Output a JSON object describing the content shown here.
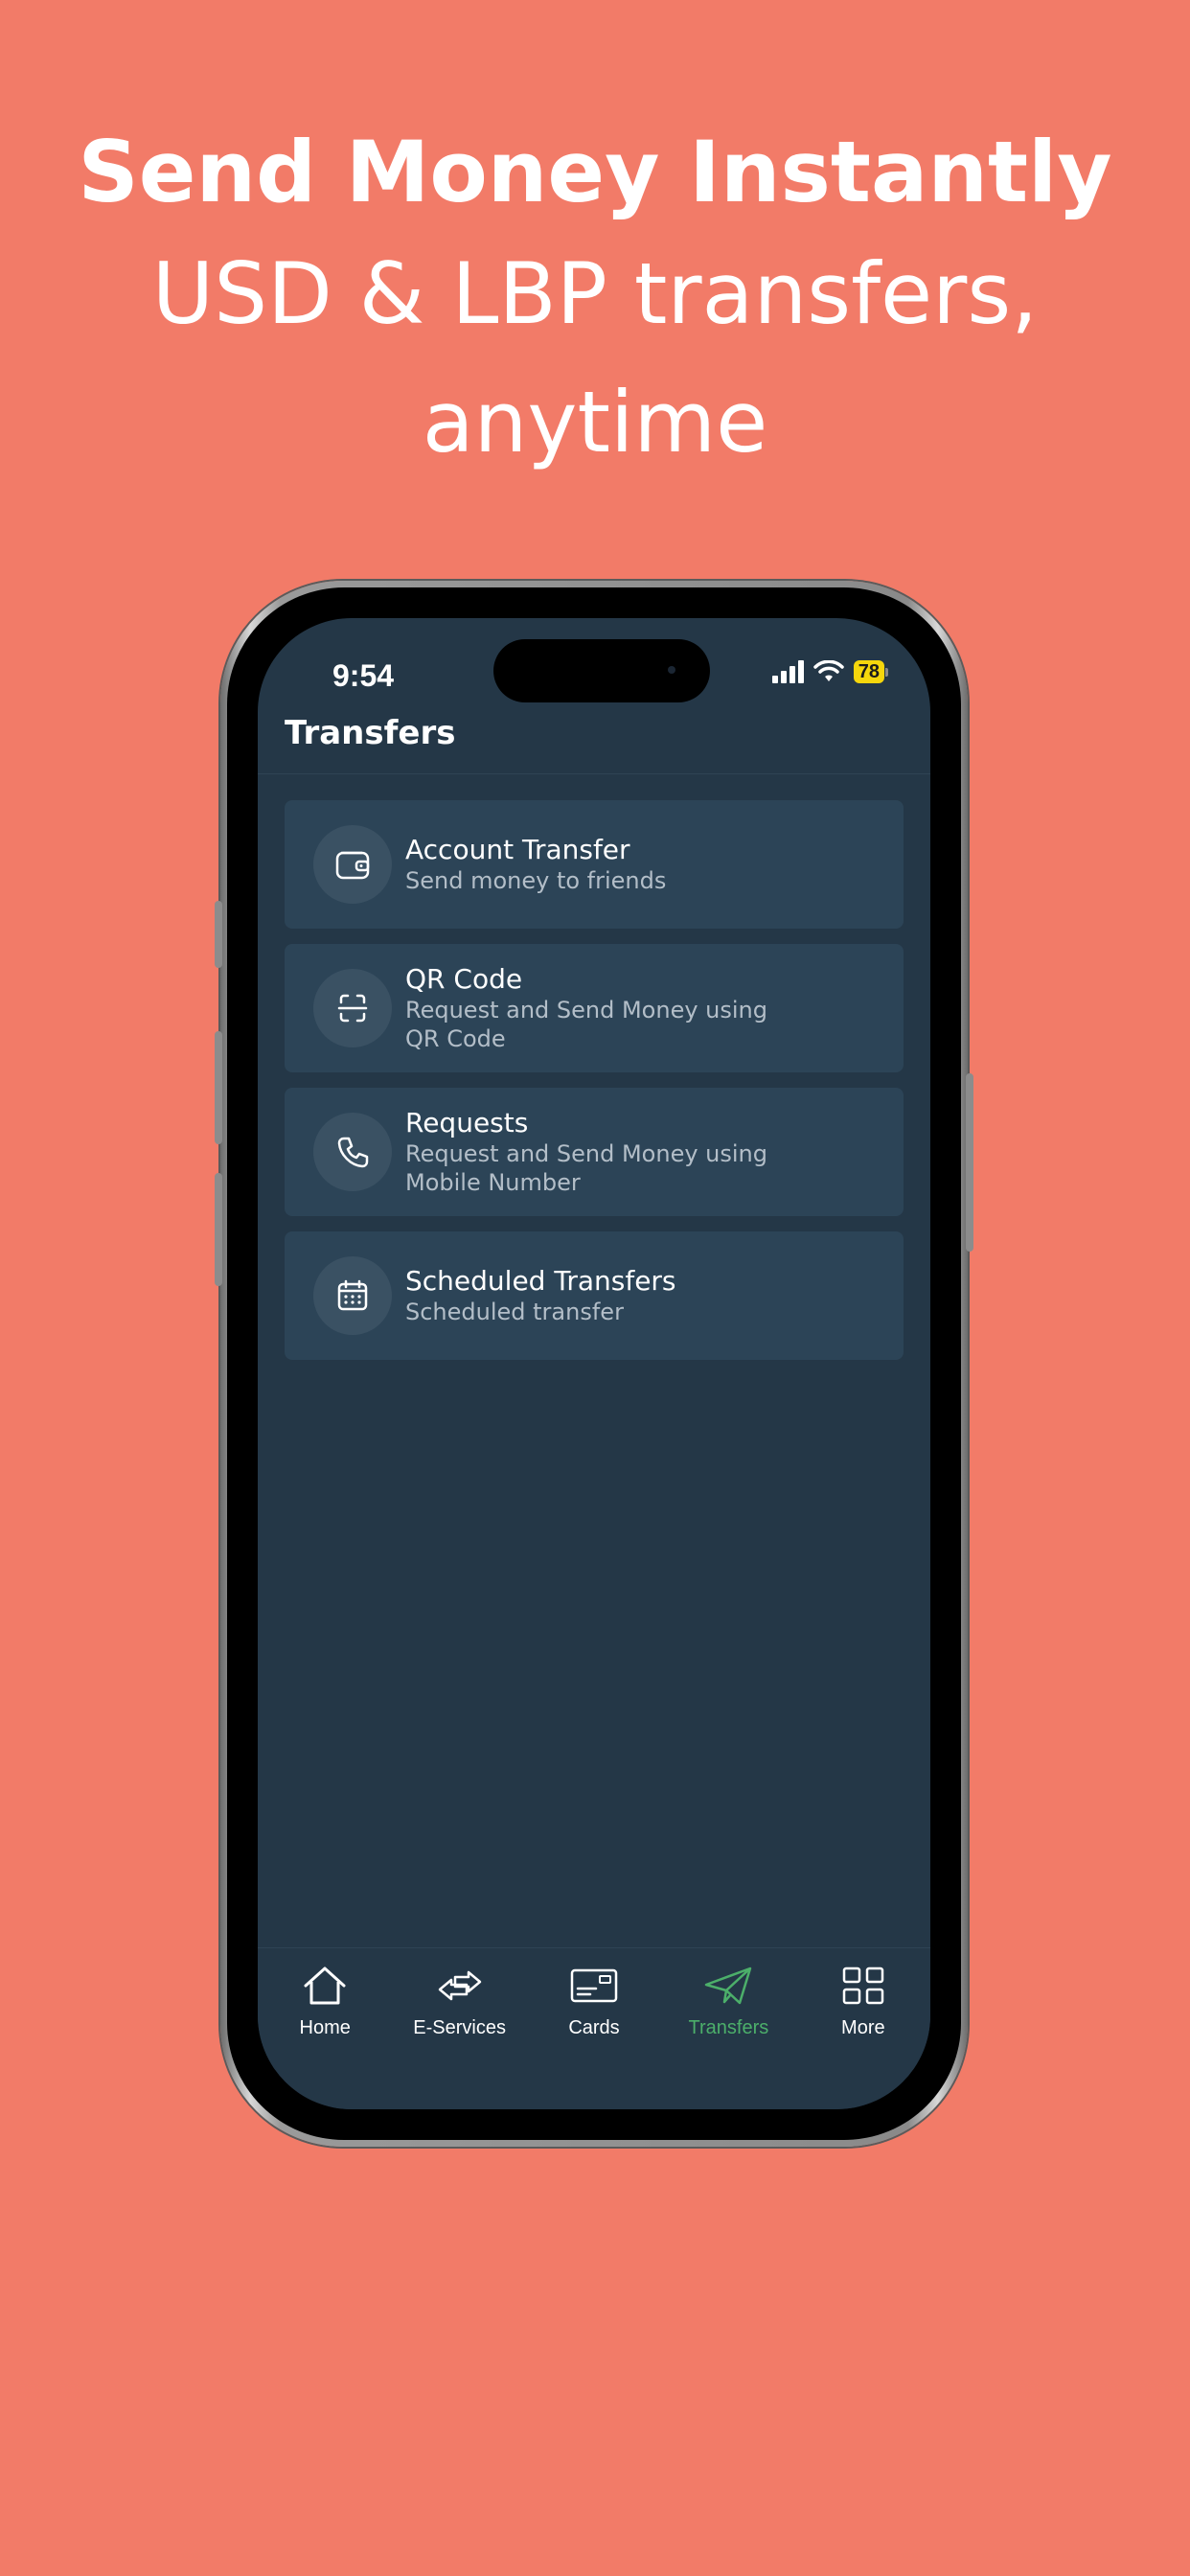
{
  "headline": {
    "title": "Send Money Instantly",
    "subtitle": "USD & LBP transfers, anytime"
  },
  "status_bar": {
    "time": "9:54",
    "battery": "78",
    "icons": [
      "signal-icon",
      "wifi-icon",
      "battery-icon"
    ]
  },
  "page": {
    "title": "Transfers"
  },
  "menu": [
    {
      "icon": "wallet-icon",
      "title": "Account Transfer",
      "subtitle": "Send money to friends"
    },
    {
      "icon": "qr-scan-icon",
      "title": "QR Code",
      "subtitle": "Request and Send Money using QR Code"
    },
    {
      "icon": "phone-icon",
      "title": "Requests",
      "subtitle": "Request and Send Money using Mobile Number"
    },
    {
      "icon": "calendar-icon",
      "title": "Scheduled Transfers",
      "subtitle": "Scheduled transfer"
    }
  ],
  "tabs": [
    {
      "icon": "home-icon",
      "label": "Home"
    },
    {
      "icon": "exchange-icon",
      "label": "E-Services"
    },
    {
      "icon": "card-icon",
      "label": "Cards"
    },
    {
      "icon": "paper-plane-icon",
      "label": "Transfers",
      "active": true
    },
    {
      "icon": "grid-icon",
      "label": "More"
    }
  ],
  "colors": {
    "background": "#f27b68",
    "screen": "#243747",
    "card": "#2c4457",
    "active_tab": "#4caf6a",
    "battery": "#f5d60c"
  }
}
